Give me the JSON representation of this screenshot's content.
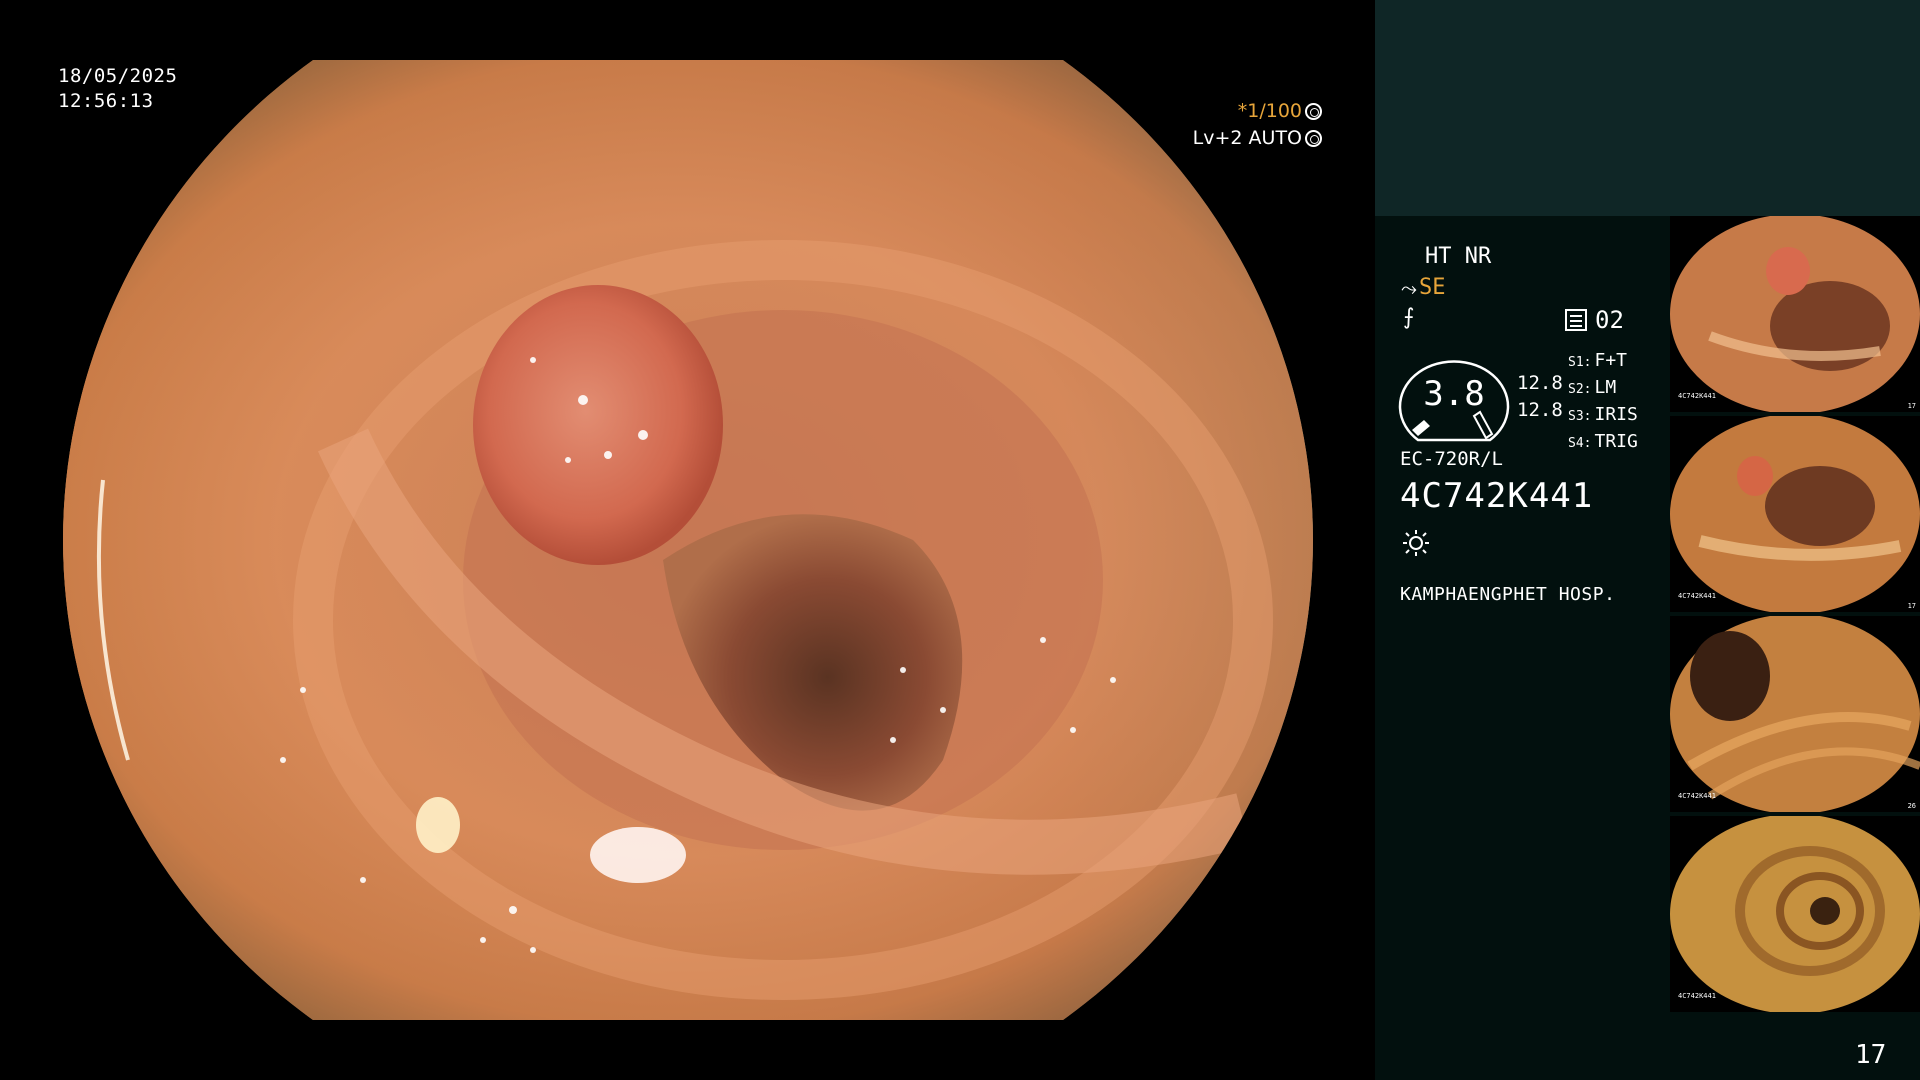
{
  "osd": {
    "date": "18/05/2025",
    "time": "12:56:13",
    "shutter": "*1/100",
    "iris_mode": "Lv+2 AUTO"
  },
  "panel": {
    "mode": "HT NR",
    "enhancement": "SE",
    "counter": "02",
    "gauge_value": "3.8",
    "reading_1": "12.8",
    "reading_2": "12.8",
    "switches": [
      {
        "key": "S1:",
        "value": "F+T"
      },
      {
        "key": "S2:",
        "value": "LM"
      },
      {
        "key": "S3:",
        "value": "IRIS"
      },
      {
        "key": "S4:",
        "value": "TRIG"
      }
    ],
    "scope_model": "EC-720R/L",
    "scope_serial": "4C742K441",
    "hospital": "KAMPHAENGPHET HOSP.",
    "icons": [
      "hook-icon",
      "f-slash-icon",
      "menu-box-icon",
      "sun-icon"
    ]
  },
  "thumbnails": [
    {
      "label": "4C742K441",
      "index": "17"
    },
    {
      "label": "4C742K441",
      "index": "17"
    },
    {
      "label": "4C742K441",
      "index": "26"
    },
    {
      "label": "4C742K441",
      "index": ""
    }
  ],
  "page_number": "17",
  "colors": {
    "accent": "#e7a53a",
    "panel_header": "#0f2626",
    "panel_bg": "#02100e"
  }
}
